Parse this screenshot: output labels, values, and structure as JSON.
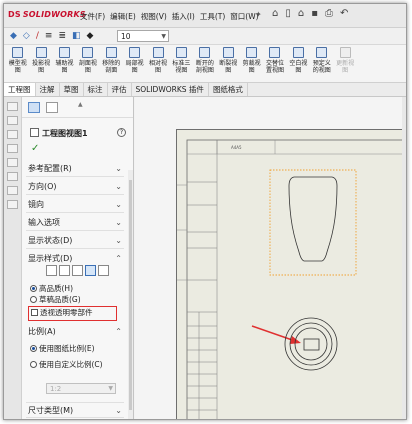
{
  "app": {
    "logo": "SOLIDWORKS",
    "menu": [
      "文件(F)",
      "编辑(E)",
      "视图(V)",
      "插入(I)",
      "工具(T)",
      "窗口(W)"
    ],
    "quick_icons": [
      "home-icon",
      "new-file-icon",
      "open-icon",
      "save-icon",
      "print-icon",
      "undo-icon"
    ]
  },
  "toolbar2": {
    "combo_value": "10"
  },
  "ribbon": {
    "buttons": [
      {
        "label": "模型视\n图",
        "enabled": true
      },
      {
        "label": "投影视\n图",
        "enabled": true
      },
      {
        "label": "辅助视\n图",
        "enabled": true
      },
      {
        "label": "剖面视\n图",
        "enabled": true
      },
      {
        "label": "移除的\n剖面",
        "enabled": true
      },
      {
        "label": "局部视\n图",
        "enabled": true
      },
      {
        "label": "相对视\n图",
        "enabled": true
      },
      {
        "label": "标准三\n视图",
        "enabled": true
      },
      {
        "label": "断开的\n剖视图",
        "enabled": true
      },
      {
        "label": "断裂视\n图",
        "enabled": true
      },
      {
        "label": "剪裁视\n图",
        "enabled": true
      },
      {
        "label": "交替位\n置视图",
        "enabled": true
      },
      {
        "label": "空白视\n图",
        "enabled": true
      },
      {
        "label": "预定义\n的视图",
        "enabled": true
      },
      {
        "label": "更新视\n图",
        "enabled": false
      }
    ]
  },
  "tabs": [
    "工程图",
    "注解",
    "草图",
    "标注",
    "评估",
    "SOLIDWORKS 插件",
    "图纸格式"
  ],
  "panel": {
    "title": "工程图视图1",
    "help": "?",
    "sections": {
      "reference_config": "参考配置(R)",
      "orientation": "方向(O)",
      "mirror": "镜向",
      "import_options": "输入选项",
      "display_state": "显示状态(D)",
      "display_style": "显示样式(D)",
      "scale": "比例(A)",
      "dimension_type": "尺寸类型(M)"
    },
    "style_radio_high": "高品质(H)",
    "style_radio_draft": "草稿品质(G)",
    "transparent_checkbox": "透视透明零部件",
    "scale_radio_sheet": "使用图纸比例(E)",
    "scale_radio_custom": "使用自定义比例(C)",
    "scale_combo_value": "1:2"
  },
  "canvas": {
    "zone_label": "A4A5"
  },
  "colors": {
    "highlight_red": "#e03030",
    "sheet_bg": "#ebebe1",
    "selection_orange": "#f0a030"
  }
}
